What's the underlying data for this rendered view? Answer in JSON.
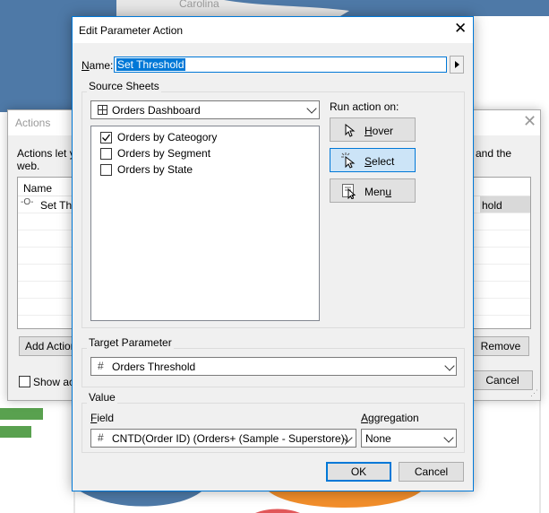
{
  "background": {
    "map_label": "Carolina",
    "actions_dialog": {
      "title": "Actions",
      "description_left": "Actions let yo",
      "description_left_2": "web.",
      "description_right": "and the",
      "column_name": "Name",
      "row_icon": "-O-",
      "row_name_left": "Set Thr",
      "row_name_right": "hold",
      "add_action_label": "Add Action",
      "remove_label": "Remove",
      "show_label": "Show act",
      "cancel_label": "Cancel"
    }
  },
  "dialog": {
    "title": "Edit Parameter Action",
    "name_label": "Name:",
    "name_value": "Set Threshold",
    "source_sheets": {
      "label": "Source Sheets",
      "dashboard": "Orders Dashboard",
      "sheets": [
        {
          "label": "Orders by Cateogory",
          "checked": true
        },
        {
          "label": "Orders by Segment",
          "checked": false
        },
        {
          "label": "Orders by State",
          "checked": false
        }
      ]
    },
    "run_action_on": {
      "label": "Run action on:",
      "options": [
        {
          "label": "Hover",
          "selected": false
        },
        {
          "label": "Select",
          "selected": true
        },
        {
          "label": "Menu",
          "selected": false
        }
      ]
    },
    "target_parameter": {
      "label": "Target Parameter",
      "value": "Orders Threshold"
    },
    "value_section": {
      "label": "Value",
      "field_label": "Field",
      "field_value": "CNTD(Order ID) (Orders+ (Sample - Superstore))",
      "aggregation_label": "Aggregation",
      "aggregation_value": "None"
    },
    "ok_label": "OK",
    "cancel_label": "Cancel"
  },
  "colors": {
    "map_blue": "#4e79a7",
    "bar_green": "#59a14f",
    "pie_orange": "#f28e2b",
    "accent": "#0078d7"
  }
}
